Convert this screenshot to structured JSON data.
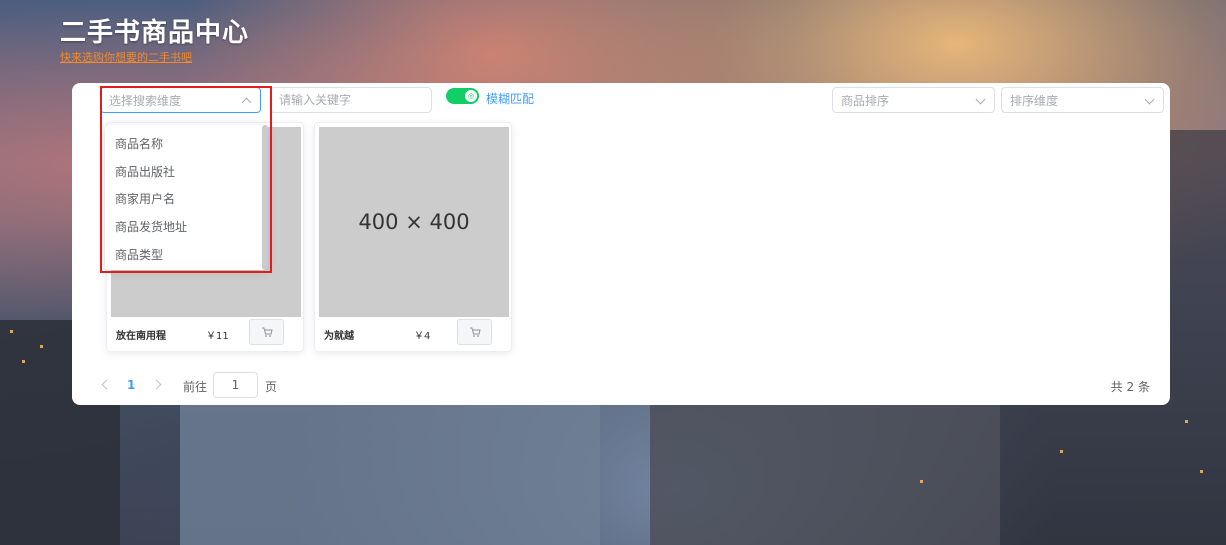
{
  "header": {
    "title": "二手书商品中心",
    "subtitle": "快来选购你想要的二手书吧"
  },
  "search": {
    "dimension_placeholder": "选择搜索维度",
    "keyword_placeholder": "请输入关键字",
    "fuzzy_label": "模糊匹配",
    "fuzzy_on": true,
    "sort_placeholder": "商品排序",
    "sort_dimension_placeholder": "排序维度"
  },
  "dimension_options": [
    "商品名称",
    "商品出版社",
    "商家用户名",
    "商品发货地址",
    "商品类型"
  ],
  "products": [
    {
      "name": "放在南用程",
      "price": "￥11",
      "image_text": ""
    },
    {
      "name": "为就越",
      "price": "￥4",
      "image_text": "400 × 400"
    }
  ],
  "pagination": {
    "current": "1",
    "goto_label": "前往",
    "goto_value": "1",
    "page_label": "页",
    "total_text": "共 2 条"
  },
  "colors": {
    "primary": "#409eff",
    "switch_on": "#13ce66",
    "highlight": "#e11d1d",
    "subtitle": "#f08a2a"
  }
}
